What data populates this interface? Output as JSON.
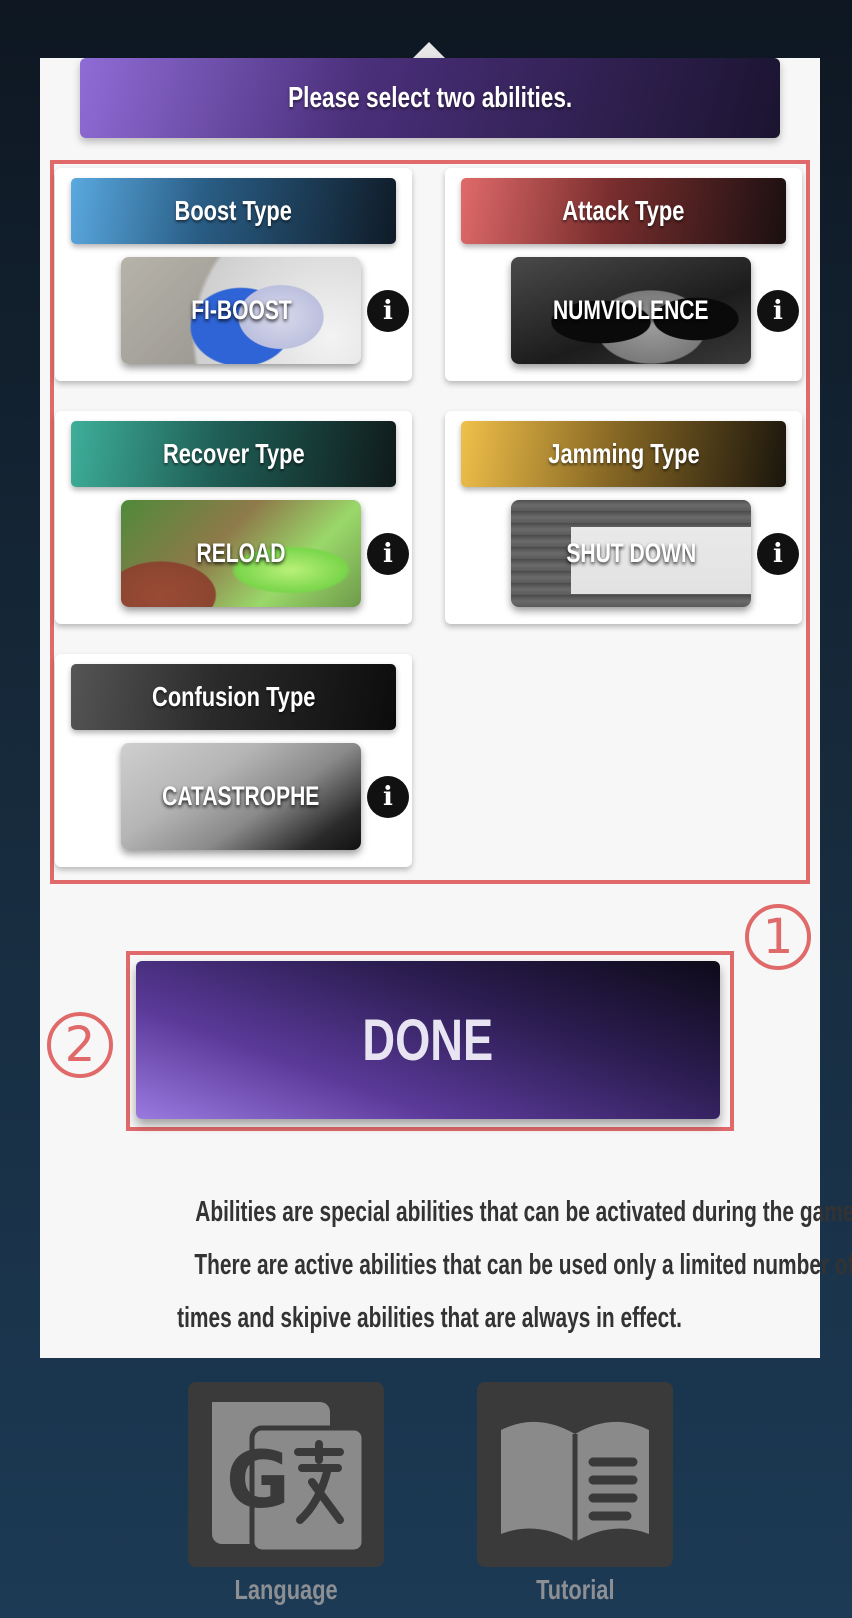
{
  "prompt": "Please select two abilities.",
  "abilities": [
    {
      "type_label": "Boost Type",
      "ability_name": "FI-BOOST"
    },
    {
      "type_label": "Attack Type",
      "ability_name": "NUMVIOLENCE"
    },
    {
      "type_label": "Recover Type",
      "ability_name": "RELOAD"
    },
    {
      "type_label": "Jamming Type",
      "ability_name": "SHUT DOWN"
    },
    {
      "type_label": "Confusion Type",
      "ability_name": "CATASTROPHE"
    }
  ],
  "done_label": "DONE",
  "markers": {
    "first": "1",
    "second": "2"
  },
  "description_lines": [
    "Abilities are special abilities that can be activated during the game.",
    "There are active abilities that can be used only a limited number of",
    "times and skipive abilities that are always in effect."
  ],
  "bottom_nav": {
    "language_label": "Language",
    "tutorial_label": "Tutorial"
  },
  "colors": {
    "highlight": "#e06a6a",
    "boost": "#5aa9e0",
    "attack": "#e06a6a",
    "recover": "#3eaf9a",
    "jamming": "#f0c04a",
    "confusion": "#555555",
    "done": "#6b4aad"
  }
}
